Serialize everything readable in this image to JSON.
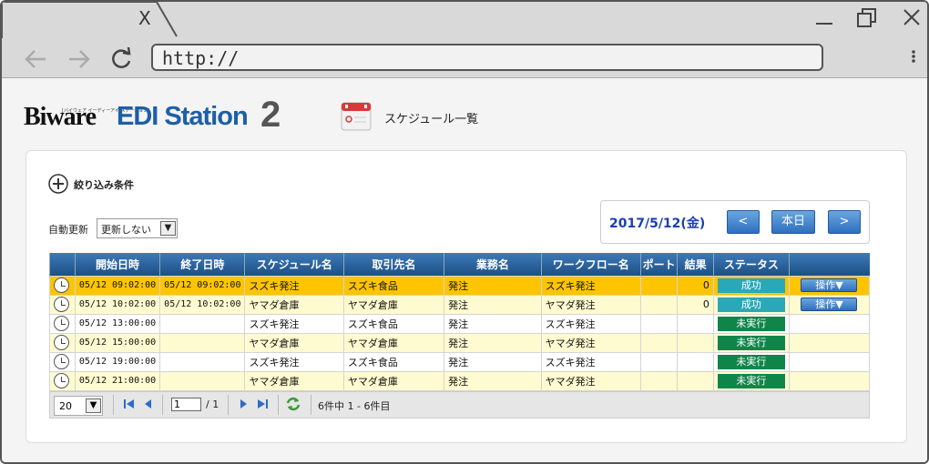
{
  "browser": {
    "tab_close": "X",
    "url": "http://"
  },
  "header": {
    "logo_biware": "Biware",
    "logo_sub": "[バイウェア イーディーアイ ステーション]",
    "logo_edi": "EDI Station",
    "logo_2": "2",
    "page_title": "スケジュール一覧"
  },
  "filter": {
    "label": "絞り込み条件",
    "auto_refresh_label": "自動更新",
    "auto_refresh_value": "更新しない"
  },
  "date_nav": {
    "date": "2017/5/12(金)",
    "prev": "<",
    "today": "本日",
    "next": ">"
  },
  "table": {
    "headers": [
      "",
      "開始日時",
      "終了日時",
      "スケジュール名",
      "取引先名",
      "業務名",
      "ワークフロー名",
      "ポート",
      "結果",
      "ステータス",
      ""
    ],
    "rows": [
      {
        "start": "05/12 09:02:00",
        "end": "05/12 09:02:00",
        "schedule": "スズキ発注",
        "partner": "スズキ食品",
        "business": "発注",
        "workflow": "スズキ発注",
        "port": "",
        "result": "0",
        "status": "成功",
        "op": "操作▼"
      },
      {
        "start": "05/12 10:02:00",
        "end": "05/12 10:02:00",
        "schedule": "ヤマダ倉庫",
        "partner": "ヤマダ倉庫",
        "business": "発注",
        "workflow": "ヤマダ発注",
        "port": "",
        "result": "0",
        "status": "成功",
        "op": "操作▼"
      },
      {
        "start": "05/12 13:00:00",
        "end": "",
        "schedule": "スズキ発注",
        "partner": "スズキ食品",
        "business": "発注",
        "workflow": "スズキ発注",
        "port": "",
        "result": "",
        "status": "未実行",
        "op": ""
      },
      {
        "start": "05/12 15:00:00",
        "end": "",
        "schedule": "ヤマダ倉庫",
        "partner": "ヤマダ倉庫",
        "business": "発注",
        "workflow": "ヤマダ発注",
        "port": "",
        "result": "",
        "status": "未実行",
        "op": ""
      },
      {
        "start": "05/12 19:00:00",
        "end": "",
        "schedule": "スズキ発注",
        "partner": "スズキ食品",
        "business": "発注",
        "workflow": "スズキ発注",
        "port": "",
        "result": "",
        "status": "未実行",
        "op": ""
      },
      {
        "start": "05/12 21:00:00",
        "end": "",
        "schedule": "ヤマダ倉庫",
        "partner": "ヤマダ倉庫",
        "business": "発注",
        "workflow": "ヤマダ発注",
        "port": "",
        "result": "",
        "status": "未実行",
        "op": ""
      }
    ]
  },
  "pager": {
    "page_size": "20",
    "page": "1",
    "total_pages": "/ 1",
    "info": "6件中 1 - 6件目"
  },
  "colors": {
    "header_blue": "#1d4f85",
    "selected_row": "#fcc500",
    "alt_row": "#fffbd0",
    "status_success": "#2aa8b8",
    "status_pending": "#10854a",
    "date_text": "#1a3fb0"
  }
}
